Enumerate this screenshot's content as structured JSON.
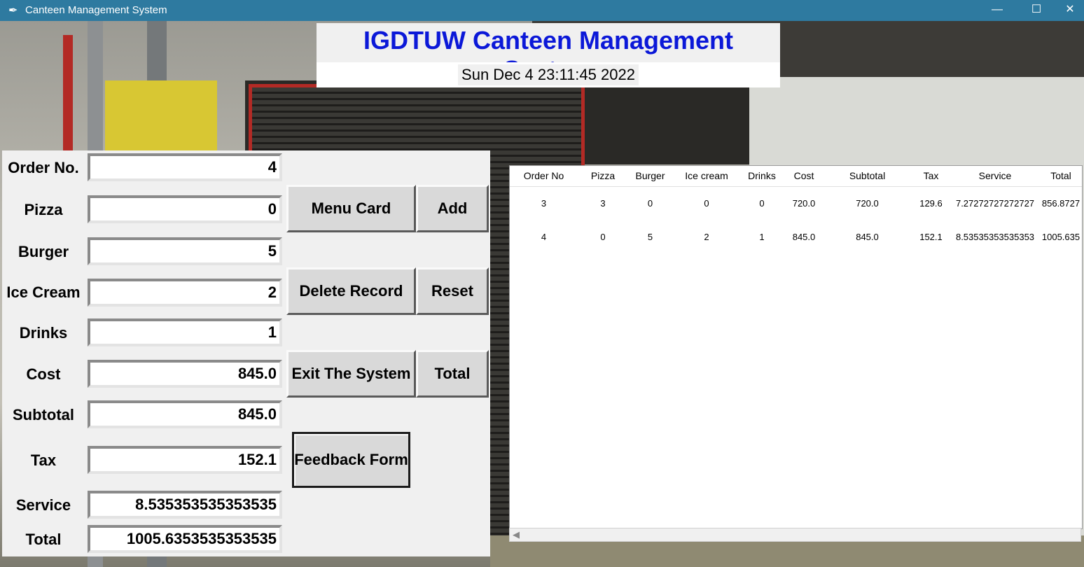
{
  "window": {
    "title": "Canteen Management System",
    "controls": {
      "minimize": "—",
      "maximize": "☐",
      "close": "✕"
    }
  },
  "header": {
    "title": "IGDTUW Canteen Management System",
    "datetime": "Sun Dec  4 23:11:45 2022"
  },
  "form": {
    "order_no": {
      "label": "Order No.",
      "value": "4"
    },
    "pizza": {
      "label": "Pizza",
      "value": "0"
    },
    "burger": {
      "label": "Burger",
      "value": "5"
    },
    "ice_cream": {
      "label": "Ice Cream",
      "value": "2"
    },
    "drinks": {
      "label": "Drinks",
      "value": "1"
    },
    "cost": {
      "label": "Cost",
      "value": "845.0"
    },
    "subtotal": {
      "label": "Subtotal",
      "value": "845.0"
    },
    "tax": {
      "label": "Tax",
      "value": "152.1"
    },
    "service": {
      "label": "Service",
      "value": "8.535353535353535"
    },
    "total": {
      "label": "Total",
      "value": "1005.6353535353535"
    }
  },
  "buttons": {
    "menu_card": "Menu Card",
    "add": "Add",
    "delete_record": "Delete Record",
    "reset": "Reset",
    "exit": "Exit The System",
    "total": "Total",
    "feedback": "Feedback Form"
  },
  "table": {
    "columns": [
      "Order No",
      "Pizza",
      "Burger",
      "Ice cream",
      "Drinks",
      "Cost",
      "Subtotal",
      "Tax",
      "Service",
      "Total"
    ],
    "rows": [
      [
        "3",
        "3",
        "0",
        "0",
        "0",
        "720.0",
        "720.0",
        "129.6",
        "7.27272727272727",
        "856.8727"
      ],
      [
        "4",
        "0",
        "5",
        "2",
        "1",
        "845.0",
        "845.0",
        "152.1",
        "8.53535353535353",
        "1005.635"
      ]
    ]
  }
}
